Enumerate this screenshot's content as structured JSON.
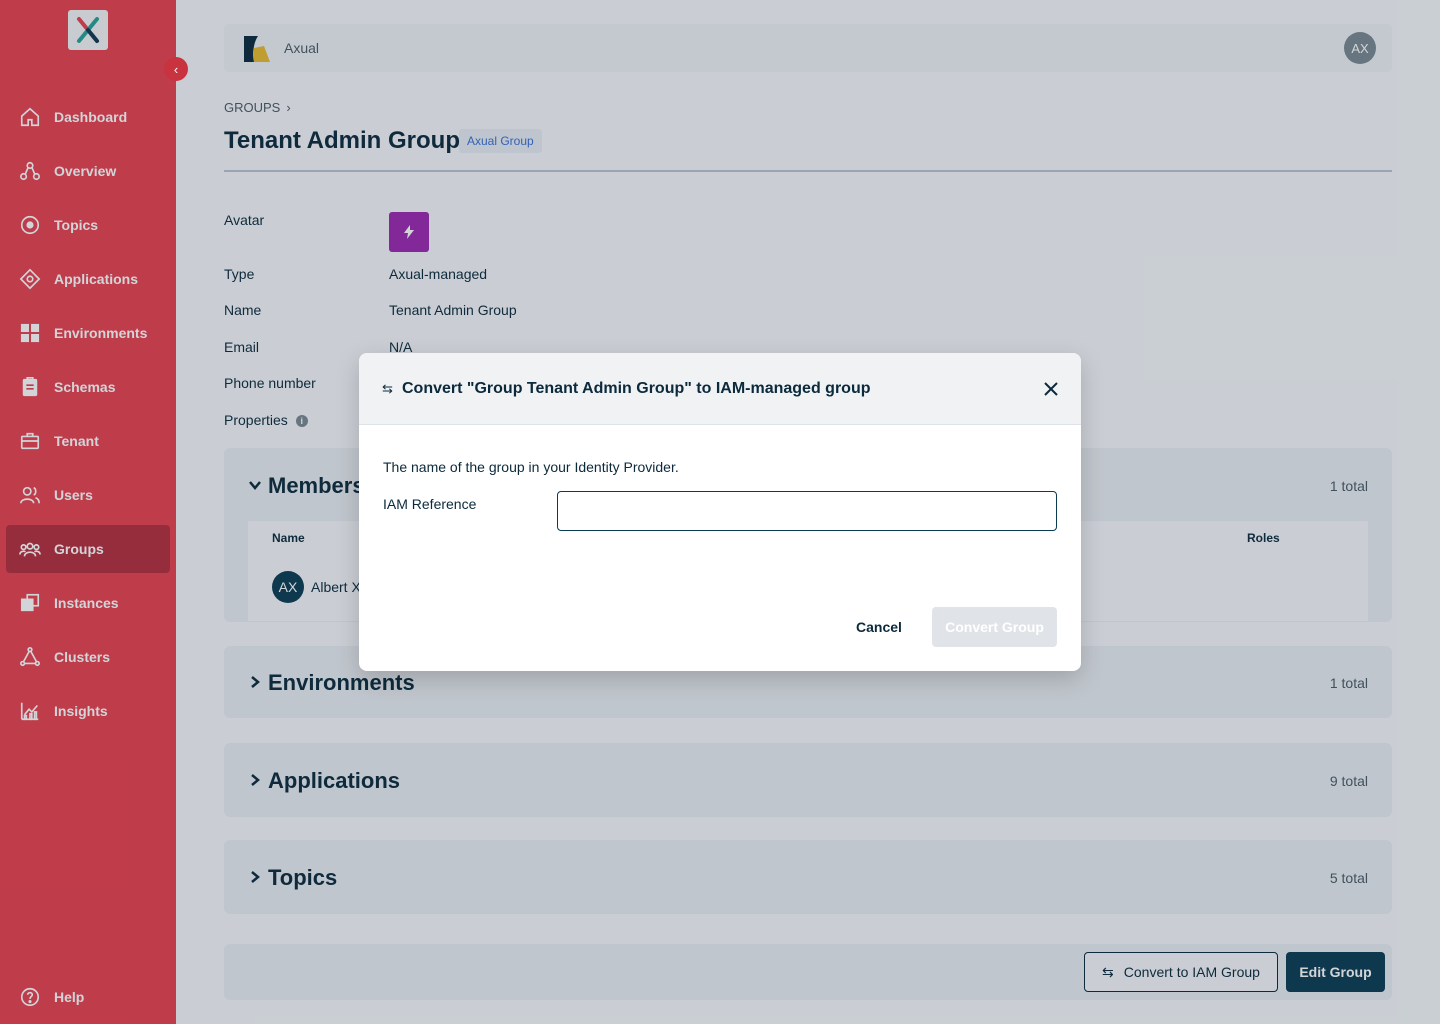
{
  "sidebar": {
    "items": [
      {
        "label": "Dashboard",
        "icon": "home-icon"
      },
      {
        "label": "Overview",
        "icon": "overview-icon"
      },
      {
        "label": "Topics",
        "icon": "topics-icon"
      },
      {
        "label": "Applications",
        "icon": "applications-icon"
      },
      {
        "label": "Environments",
        "icon": "environments-icon"
      },
      {
        "label": "Schemas",
        "icon": "schemas-icon"
      },
      {
        "label": "Tenant",
        "icon": "tenant-icon"
      },
      {
        "label": "Users",
        "icon": "users-icon"
      },
      {
        "label": "Groups",
        "icon": "groups-icon",
        "active": true
      },
      {
        "label": "Instances",
        "icon": "instances-icon"
      },
      {
        "label": "Clusters",
        "icon": "clusters-icon"
      },
      {
        "label": "Insights",
        "icon": "insights-icon"
      }
    ],
    "help": "Help"
  },
  "topbar": {
    "org_name": "Axual",
    "user_initials": "AX"
  },
  "breadcrumb": {
    "groups": "GROUPS"
  },
  "page": {
    "title": "Tenant Admin Group",
    "badge": "Axual Group"
  },
  "properties": {
    "avatar_label": "Avatar",
    "type_label": "Type",
    "type_value": "Axual-managed",
    "name_label": "Name",
    "name_value": "Tenant Admin Group",
    "email_label": "Email",
    "email_value": "N/A",
    "phone_label": "Phone number",
    "properties_label": "Properties"
  },
  "sections": {
    "members": {
      "title": "Members",
      "count": "1 total",
      "columns": {
        "name": "Name",
        "roles": "Roles"
      },
      "rows": [
        {
          "initials": "AX",
          "name": "Albert X"
        }
      ]
    },
    "environments": {
      "title": "Environments",
      "count": "1 total"
    },
    "applications": {
      "title": "Applications",
      "count": "9 total"
    },
    "topics": {
      "title": "Topics",
      "count": "5 total"
    }
  },
  "footer": {
    "convert_label": "Convert to IAM Group",
    "edit_label": "Edit Group"
  },
  "modal": {
    "title": "Convert \"Group Tenant Admin Group\" to IAM-managed group",
    "description": "The name of the group in your Identity Provider.",
    "field_label": "IAM Reference",
    "field_value": "",
    "cancel_label": "Cancel",
    "convert_label": "Convert Group"
  },
  "colors": {
    "sidebar": "#e8404f",
    "sidebar_active": "#b42e3c",
    "primary": "#0b3b52",
    "badge_text": "#3b6fd1",
    "group_avatar": "#9c27b0"
  }
}
